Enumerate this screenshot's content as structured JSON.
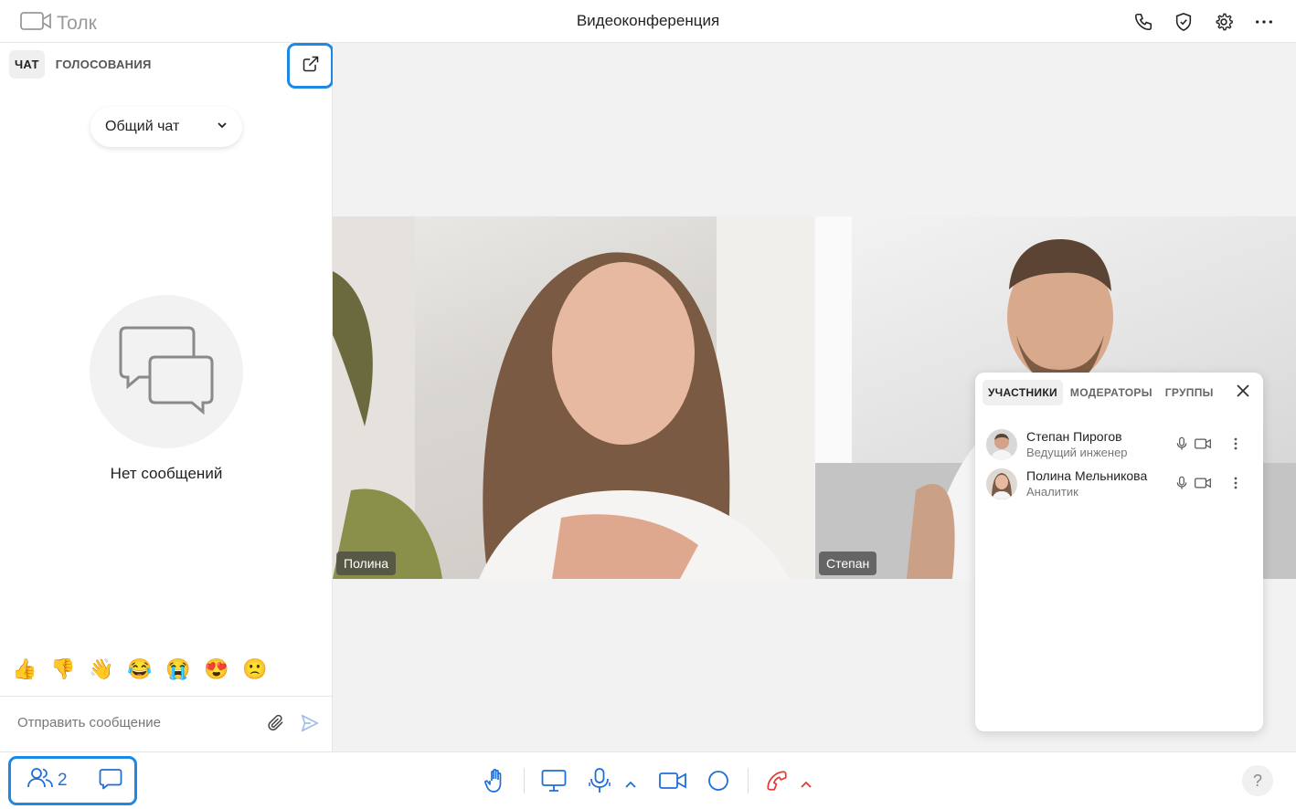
{
  "app": {
    "name": "Толк",
    "title": "Видеоконференция"
  },
  "topbar_icons": [
    "phone-icon",
    "shield-check-icon",
    "gear-icon",
    "more-horizontal-icon"
  ],
  "sidebar": {
    "tabs": [
      {
        "label": "ЧАТ",
        "active": true
      },
      {
        "label": "ГОЛОСОВАНИЯ",
        "active": false
      }
    ],
    "chat_select": "Общий чат",
    "empty_text": "Нет сообщений",
    "emojis": [
      "👍",
      "👎",
      "👋",
      "😂",
      "😭",
      "😍",
      "🙁"
    ],
    "message_placeholder": "Отправить сообщение"
  },
  "videos": [
    {
      "name": "Полина"
    },
    {
      "name": "Степан"
    }
  ],
  "participants_panel": {
    "tabs": [
      {
        "label": "УЧАСТНИКИ",
        "active": true
      },
      {
        "label": "МОДЕРАТОРЫ",
        "active": false
      },
      {
        "label": "ГРУППЫ",
        "active": false
      }
    ],
    "people": [
      {
        "name": "Степан Пирогов",
        "role": "Ведущий инженер"
      },
      {
        "name": "Полина Мельникова",
        "role": "Аналитик"
      }
    ]
  },
  "bottombar": {
    "participants_count": "2",
    "help": "?"
  },
  "colors": {
    "accent": "#1e88e5",
    "icon_blue": "#1e6fd9",
    "hangup": "#e53935"
  }
}
